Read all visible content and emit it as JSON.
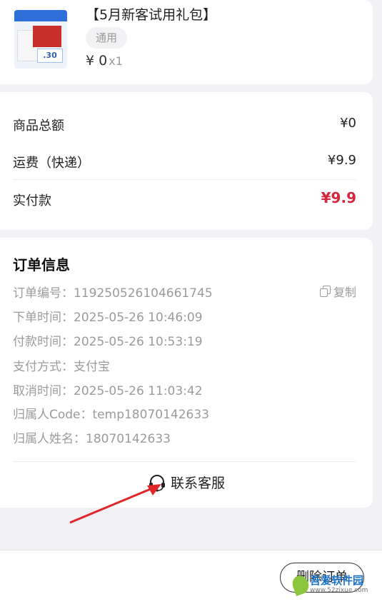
{
  "product": {
    "title": "【5月新客试用礼包】",
    "tag": "通用",
    "price": "¥ 0",
    "quantity": "x1",
    "thumb_badge": ".30"
  },
  "amounts": {
    "goods_total_label": "商品总额",
    "goods_total_value": "¥0",
    "shipping_label": "运费（快递）",
    "shipping_value": "¥9.9",
    "paid_label": "实付款",
    "paid_value": "¥9.9"
  },
  "order_info": {
    "title": "订单信息",
    "order_no": "订单编号：119250526104661745",
    "order_time": "下单时间：2025-05-26 10:46:09",
    "pay_time": "付款时间：2025-05-26 10:53:19",
    "pay_method": "支付方式：支付宝",
    "cancel_time": "取消时间：2025-05-26 11:03:42",
    "owner_code": "归属人Code：temp18070142633",
    "owner_name": "归属人姓名：18070142633",
    "copy_label": "复制",
    "service_label": "联系客服"
  },
  "bottom": {
    "delete_label": "删除订单",
    "watermark_main": "吾爱软件园",
    "watermark_sub": "www.52zixue.com"
  },
  "colors": {
    "accent_red": "#d6253f",
    "annotation_arrow": "#e0262a",
    "background": "#f2f2f6"
  },
  "icons": {
    "copy": "copy-icon",
    "service": "headset-icon"
  }
}
